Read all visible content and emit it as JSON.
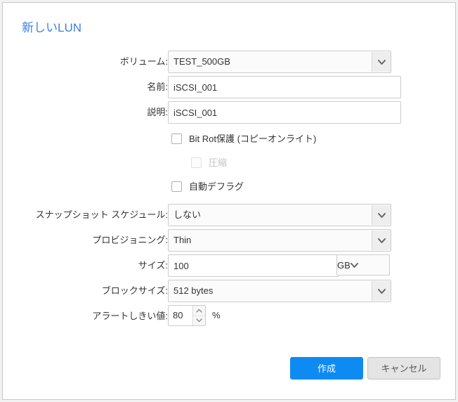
{
  "dialog": {
    "title": "新しいLUN"
  },
  "fields": {
    "volume": {
      "label": "ボリューム:",
      "value": "TEST_500GB",
      "icon": "chevron-down-icon"
    },
    "name": {
      "label": "名前:",
      "value": "iSCSI_001",
      "placeholder": ""
    },
    "description": {
      "label": "説明:",
      "value": "iSCSI_001",
      "placeholder": ""
    },
    "bit_rot": {
      "label": "Bit Rot保護 (コピーオンライト)",
      "checked": false,
      "disabled": false
    },
    "compression": {
      "label": "圧縮",
      "checked": false,
      "disabled": true
    },
    "auto_defrag": {
      "label": "自動デフラグ",
      "checked": false,
      "disabled": false
    },
    "snapshot_schedule": {
      "label": "スナップショット スケジュール:",
      "value": "しない",
      "icon": "chevron-down-icon"
    },
    "provisioning": {
      "label": "プロビジョニング:",
      "value": "Thin",
      "icon": "chevron-down-icon"
    },
    "size": {
      "label": "サイズ:",
      "value": "100",
      "unit": "GB",
      "unit_icon": "chevron-down-icon"
    },
    "block_size": {
      "label": "ブロックサイズ:",
      "value": "512 bytes",
      "icon": "chevron-down-icon"
    },
    "alert_threshold": {
      "label": "アラートしきい値:",
      "value": "80",
      "suffix": "%",
      "up_icon": "chevron-up-icon",
      "down_icon": "chevron-down-icon"
    }
  },
  "footer": {
    "create_label": "作成",
    "cancel_label": "キャンセル"
  },
  "colors": {
    "title": "#3f7fe0",
    "primary_button": "#0d8bf2",
    "secondary_button": "#e4e4e4",
    "panel_border": "#c8c8c8",
    "disabled_text": "#c4c4c4"
  }
}
